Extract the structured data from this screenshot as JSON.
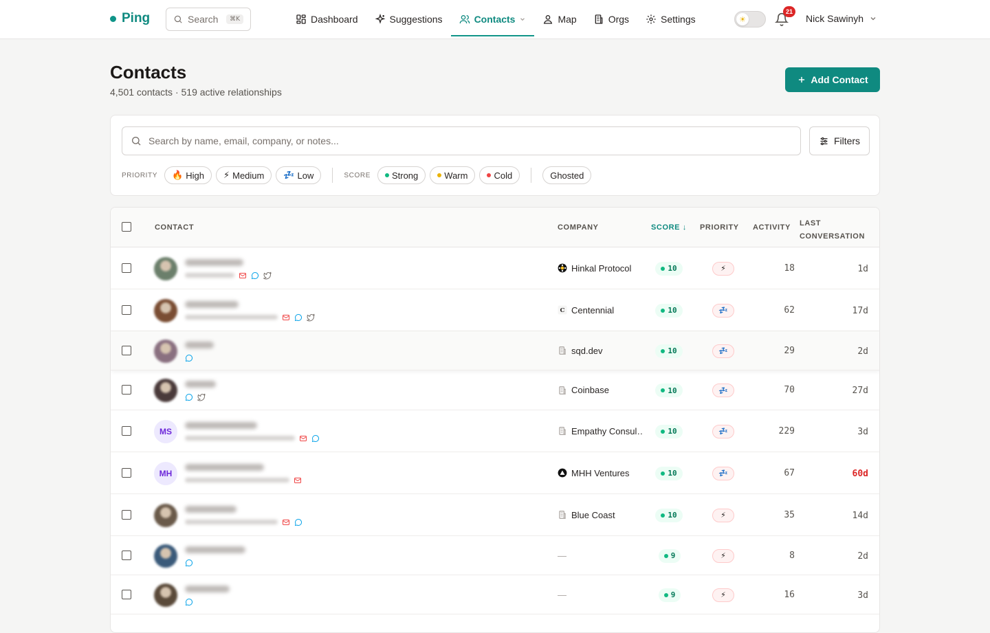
{
  "brand": {
    "name": "Ping",
    "color": "#0f9488"
  },
  "global_search": {
    "placeholder": "Search",
    "shortcut": "⌘K"
  },
  "nav": [
    {
      "label": "Dashboard",
      "icon": "dashboard-icon",
      "active": false
    },
    {
      "label": "Suggestions",
      "icon": "sparkles-icon",
      "active": false
    },
    {
      "label": "Contacts",
      "icon": "users-icon",
      "active": true
    },
    {
      "label": "Map",
      "icon": "map-person-icon",
      "active": false
    },
    {
      "label": "Orgs",
      "icon": "building-icon",
      "active": false
    },
    {
      "label": "Settings",
      "icon": "gear-icon",
      "active": false
    }
  ],
  "theme_toggle": {
    "icon": "sun-icon"
  },
  "notifications": {
    "count": "21"
  },
  "user": {
    "name": "Nick Sawinyh"
  },
  "page": {
    "title": "Contacts",
    "subtitle": "4,501 contacts · 519 active relationships",
    "add_button": "Add Contact"
  },
  "filters": {
    "search_placeholder": "Search by name, email, company, or notes...",
    "filters_button": "Filters",
    "priority_label": "PRIORITY",
    "priority_chips": [
      {
        "label": "High",
        "icon": "🔥"
      },
      {
        "label": "Medium",
        "icon": "⚡"
      },
      {
        "label": "Low",
        "icon": "💤"
      }
    ],
    "score_label": "SCORE",
    "score_chips": [
      {
        "label": "Strong",
        "color": "#10b981"
      },
      {
        "label": "Warm",
        "color": "#eab308"
      },
      {
        "label": "Cold",
        "color": "#ef4444"
      }
    ],
    "ghosted_chip": "Ghosted"
  },
  "table": {
    "columns": {
      "contact": "CONTACT",
      "company": "COMPANY",
      "score": "SCORE",
      "priority": "PRIORITY",
      "activity": "ACTIVITY",
      "last_conversation_1": "LAST",
      "last_conversation_2": "CONVERSATION"
    },
    "rows": [
      {
        "avatar": "photo",
        "company": "Hinkal Protocol",
        "company_icon": "hinkal-logo-icon",
        "score": "10",
        "priority": "⚡",
        "activity": "18",
        "last": "1d",
        "channels": [
          "mail",
          "chat",
          "twitter"
        ]
      },
      {
        "avatar": "photo",
        "company": "Centennial",
        "company_icon": "centennial-logo-icon",
        "score": "10",
        "priority": "💤",
        "activity": "62",
        "last": "17d",
        "channels": [
          "mail",
          "chat",
          "twitter"
        ]
      },
      {
        "avatar": "photo",
        "company": "sqd.dev",
        "company_icon": "building-icon",
        "score": "10",
        "priority": "💤",
        "activity": "29",
        "last": "2d",
        "channels": [
          "chat"
        ]
      },
      {
        "avatar": "photo",
        "company": "Coinbase",
        "company_icon": "building-icon",
        "score": "10",
        "priority": "💤",
        "activity": "70",
        "last": "27d",
        "channels": [
          "chat",
          "twitter"
        ]
      },
      {
        "avatar": "MS",
        "company": "Empathy Consul…",
        "company_icon": "building-icon",
        "score": "10",
        "priority": "💤",
        "activity": "229",
        "last": "3d",
        "channels": [
          "mail",
          "chat"
        ]
      },
      {
        "avatar": "MH",
        "company": "MHH Ventures",
        "company_icon": "mhh-logo-icon",
        "score": "10",
        "priority": "💤",
        "activity": "67",
        "last": "60d",
        "channels": [
          "mail"
        ]
      },
      {
        "avatar": "photo",
        "company": "Blue Coast",
        "company_icon": "building-icon",
        "score": "10",
        "priority": "⚡",
        "activity": "35",
        "last": "14d",
        "channels": [
          "mail",
          "chat"
        ]
      },
      {
        "avatar": "photo",
        "company": "—",
        "company_icon": "",
        "score": "9",
        "priority": "⚡",
        "activity": "8",
        "last": "2d",
        "channels": [
          "chat"
        ]
      },
      {
        "avatar": "photo",
        "company": "—",
        "company_icon": "",
        "score": "9",
        "priority": "⚡",
        "activity": "16",
        "last": "3d",
        "channels": [
          "chat"
        ]
      }
    ]
  },
  "colors": {
    "accent": "#0f8a80",
    "strong": "#10b981",
    "stale": "#dc2626",
    "mail": "#ef4444",
    "chat": "#0ea5e9",
    "twitter": "#78716c"
  }
}
